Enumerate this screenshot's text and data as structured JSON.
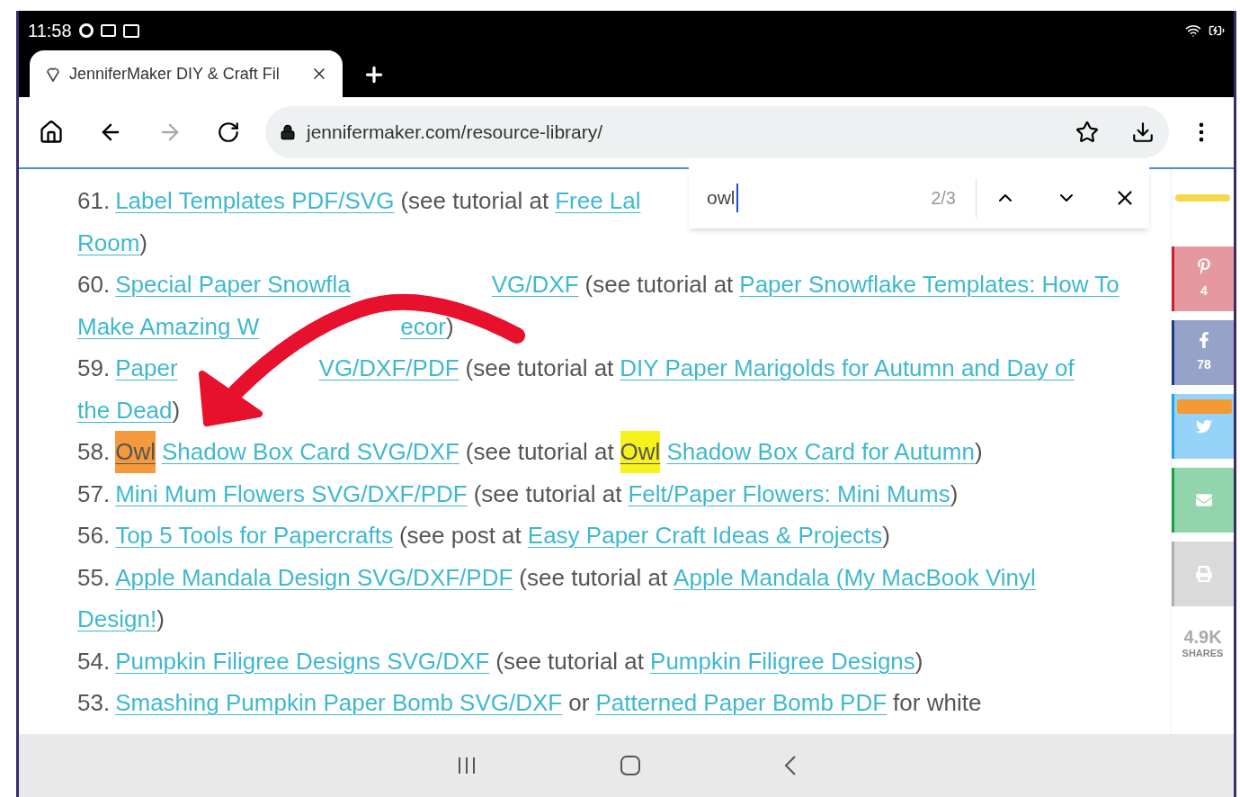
{
  "status_bar": {
    "time": "11:58"
  },
  "tab": {
    "title": "JenniferMaker DIY & Craft Fil"
  },
  "address_bar": {
    "url": "jennifermaker.com/resource-library/"
  },
  "find_bar": {
    "value": "owl",
    "count": "2/3"
  },
  "items": [
    {
      "number": "61.",
      "lines": [
        [
          {
            "kind": "link",
            "text": "Label Templates PDF/SVG"
          },
          {
            "kind": "text",
            "text": "(see tutorial at"
          },
          {
            "kind": "link",
            "text": "Free Lal"
          }
        ],
        [
          {
            "kind": "link",
            "text": "Room"
          },
          {
            "kind": "close",
            "text": ")"
          }
        ]
      ]
    },
    {
      "number": "60.",
      "lines": [
        [
          {
            "kind": "link",
            "text": "Special Paper Snowfla"
          },
          {
            "kind": "gap"
          },
          {
            "kind": "link",
            "text": "VG/DXF"
          },
          {
            "kind": "text",
            "text": "(see tutorial at"
          },
          {
            "kind": "link",
            "text": "Paper Snowflake Templates: How To"
          }
        ],
        [
          {
            "kind": "link",
            "text": "Make Amazing W"
          },
          {
            "kind": "gap"
          },
          {
            "kind": "link",
            "text": "ecor"
          },
          {
            "kind": "close",
            "text": ")"
          }
        ]
      ]
    },
    {
      "number": "59.",
      "lines": [
        [
          {
            "kind": "link",
            "text": "Paper"
          },
          {
            "kind": "gap"
          },
          {
            "kind": "link",
            "text": "VG/DXF/PDF"
          },
          {
            "kind": "text",
            "text": "(see tutorial at"
          },
          {
            "kind": "link",
            "text": "DIY Paper Marigolds for Autumn and Day of"
          }
        ],
        [
          {
            "kind": "link",
            "text": "the Dead"
          },
          {
            "kind": "close",
            "text": ")"
          }
        ]
      ]
    },
    {
      "number": "58.",
      "lines": [
        [
          {
            "kind": "match",
            "text": "Owl",
            "selected": true
          },
          {
            "kind": "link",
            "text": "Shadow Box Card SVG/DXF"
          },
          {
            "kind": "text",
            "text": "(see tutorial at"
          },
          {
            "kind": "match",
            "text": "Owl",
            "selected": false
          },
          {
            "kind": "link",
            "text": "Shadow Box Card for Autumn"
          },
          {
            "kind": "close",
            "text": ")"
          }
        ]
      ]
    },
    {
      "number": "57.",
      "lines": [
        [
          {
            "kind": "link",
            "text": "Mini Mum Flowers SVG/DXF/PDF"
          },
          {
            "kind": "text",
            "text": "(see tutorial at"
          },
          {
            "kind": "link",
            "text": "Felt/Paper Flowers: Mini Mums"
          },
          {
            "kind": "close",
            "text": ")"
          }
        ]
      ]
    },
    {
      "number": "56.",
      "lines": [
        [
          {
            "kind": "link",
            "text": "Top 5 Tools for Papercrafts"
          },
          {
            "kind": "text",
            "text": "(see post at"
          },
          {
            "kind": "link",
            "text": "Easy Paper Craft Ideas & Projects"
          },
          {
            "kind": "close",
            "text": ")"
          }
        ]
      ]
    },
    {
      "number": "55.",
      "lines": [
        [
          {
            "kind": "link",
            "text": "Apple Mandala Design SVG/DXF/PDF"
          },
          {
            "kind": "text",
            "text": "(see tutorial at"
          },
          {
            "kind": "link",
            "text": "Apple Mandala (My MacBook Vinyl"
          }
        ],
        [
          {
            "kind": "link",
            "text": "Design!"
          },
          {
            "kind": "close",
            "text": ")"
          }
        ]
      ]
    },
    {
      "number": "54.",
      "lines": [
        [
          {
            "kind": "link",
            "text": "Pumpkin Filigree Designs SVG/DXF"
          },
          {
            "kind": "text",
            "text": "(see tutorial at"
          },
          {
            "kind": "link",
            "text": "Pumpkin Filigree Designs"
          },
          {
            "kind": "close",
            "text": ")"
          }
        ]
      ]
    },
    {
      "number": "53.",
      "lines": [
        [
          {
            "kind": "link",
            "text": "Smashing Pumpkin Paper Bomb SVG/DXF"
          },
          {
            "kind": "text",
            "text": "or"
          },
          {
            "kind": "link",
            "text": "Patterned Paper Bomb PDF"
          },
          {
            "kind": "text",
            "text": "for white"
          }
        ]
      ]
    }
  ],
  "share_bar": {
    "buttons": [
      {
        "kind": "pinterest",
        "color": "#c8232c",
        "count": "4"
      },
      {
        "kind": "facebook",
        "color": "#1e3a8a",
        "count": "78"
      },
      {
        "kind": "twitter",
        "color": "#1da1f2"
      },
      {
        "kind": "email",
        "color": "#16a34a"
      },
      {
        "kind": "print",
        "color": "#b0b0b0"
      }
    ],
    "total": "4.9K",
    "total_label": "SHARES"
  }
}
